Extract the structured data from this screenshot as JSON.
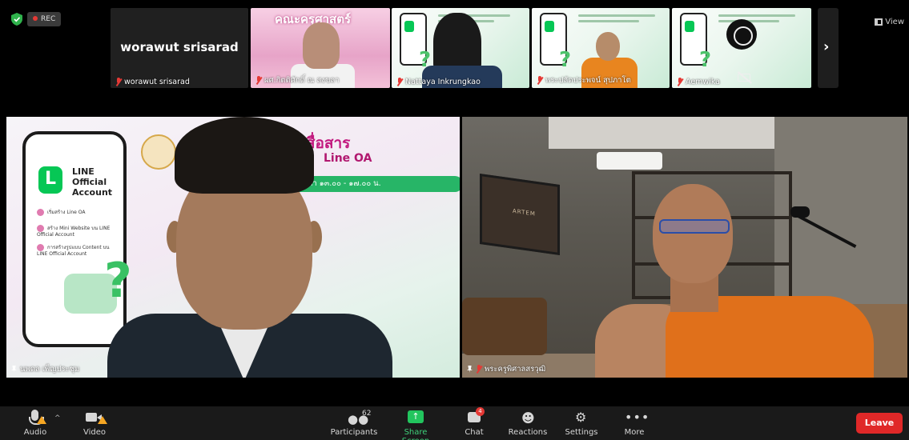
{
  "topbar": {
    "rec_label": "REC",
    "view_label": "View"
  },
  "filmstrip": {
    "self_display_name": "worawut srisarad",
    "tiles": [
      {
        "name": "worawut srisarad"
      },
      {
        "name": "ผศ.กิตติศักดิ์ ณ สงขลา",
        "banner_text": "คณะครุศาสตร์"
      },
      {
        "name": "Nattaya Inkrungkao"
      },
      {
        "name": "พระปลัดประพจน์ สุปภาโต"
      },
      {
        "name": "Aemwika"
      }
    ]
  },
  "main": {
    "left_speaker_name": "นพดล เพ็ญประชุม",
    "right_speaker_name": "พระครูพิศาลสรวุฒิ",
    "slide": {
      "title_line1": "ารสื่อสาร",
      "title_line2": "Line OA",
      "pill_text": "เวลา ๑๓.๐๐ - ๑๗.๐๐ น.",
      "brand_line1": "LINE",
      "brand_line2": "Official",
      "brand_line3": "Account",
      "menu": [
        "เริ่มสร้าง Line OA",
        "สร้าง Mini Website บน LINE Official Account",
        "การสร้างรูปแบบ Content บน LINE Official Account"
      ]
    }
  },
  "toolbar": {
    "audio_label": "Audio",
    "video_label": "Video",
    "participants_label": "Participants",
    "participants_count": "62",
    "share_label": "Share Screen",
    "chat_label": "Chat",
    "chat_badge": "4",
    "reactions_label": "Reactions",
    "settings_label": "Settings",
    "more_label": "More",
    "leave_label": "Leave"
  },
  "colors": {
    "leave": "#e02828",
    "share": "#22c55e",
    "line_green": "#06c755",
    "slide_pink": "#c2187e",
    "robe_orange": "#e0701b"
  }
}
